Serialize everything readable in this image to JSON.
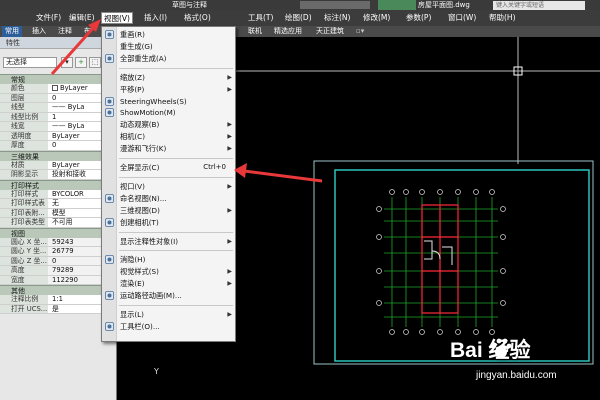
{
  "titlebar": {
    "title": "草图与注释",
    "file": "房屋平面图.dwg",
    "search_placeholder": "键入关键字或短语"
  },
  "menubar": {
    "items": [
      "文件(F)",
      "编辑(E)",
      "视图(V)",
      "插入(I)",
      "格式(O)",
      "工具(T)",
      "绘图(D)",
      "标注(N)",
      "修改(M)",
      "参数(P)",
      "窗口(W)",
      "帮助(H)"
    ],
    "active": "视图(V)"
  },
  "ribbon": {
    "tabs": [
      "常用",
      "插入",
      "注释",
      "布",
      "联机",
      "精选应用",
      "天正建筑"
    ]
  },
  "properties": {
    "title": "特性",
    "selection": "无选择",
    "sections": [
      {
        "name": "常规",
        "rows": [
          [
            "颜色",
            "ByLayer"
          ],
          [
            "图层",
            "0"
          ],
          [
            "线型",
            "—— ByLa"
          ],
          [
            "线型比例",
            "1"
          ],
          [
            "线宽",
            "—— ByLa"
          ],
          [
            "透明度",
            "ByLayer"
          ],
          [
            "厚度",
            "0"
          ]
        ]
      },
      {
        "name": "三维效果",
        "rows": [
          [
            "材质",
            "ByLayer"
          ],
          [
            "阴影显示",
            "投射和接收"
          ]
        ]
      },
      {
        "name": "打印样式",
        "rows": [
          [
            "打印样式",
            "BYCOLOR"
          ],
          [
            "打印样式表",
            "无"
          ],
          [
            "打印表附...",
            "模型"
          ],
          [
            "打印表类型",
            "不可用"
          ]
        ]
      },
      {
        "name": "视图",
        "rows": [
          [
            "圆心 X 坐...",
            "59243"
          ],
          [
            "圆心 Y 坐...",
            "26779"
          ],
          [
            "圆心 Z 坐...",
            "0"
          ],
          [
            "高度",
            "79289"
          ],
          [
            "宽度",
            "112290"
          ]
        ]
      },
      {
        "name": "其他",
        "rows": [
          [
            "注释比例",
            "1:1"
          ],
          [
            "打开 UCS...",
            "是"
          ]
        ]
      }
    ]
  },
  "view_menu": {
    "items": [
      {
        "label": "重画(R)",
        "icon": "redraw-icon"
      },
      {
        "label": "重生成(G)"
      },
      {
        "label": "全部重生成(A)",
        "icon": "regen-all-icon"
      },
      {
        "sep": true
      },
      {
        "label": "缩放(Z)",
        "sub": true
      },
      {
        "label": "平移(P)",
        "sub": true
      },
      {
        "label": "SteeringWheels(S)",
        "icon": "steeringwheel-icon"
      },
      {
        "label": "ShowMotion(M)",
        "icon": "showmotion-icon"
      },
      {
        "label": "动态观察(B)",
        "sub": true
      },
      {
        "label": "相机(C)",
        "sub": true
      },
      {
        "label": "漫游和飞行(K)",
        "sub": true
      },
      {
        "sep": true
      },
      {
        "label": "全屏显示(C)",
        "shortcut": "Ctrl+0"
      },
      {
        "sep": true
      },
      {
        "label": "视口(V)",
        "sub": true
      },
      {
        "label": "命名视图(N)...",
        "icon": "named-views-icon"
      },
      {
        "label": "三维视图(D)",
        "sub": true
      },
      {
        "label": "创建相机(T)",
        "icon": "create-camera-icon"
      },
      {
        "sep": true
      },
      {
        "label": "显示注释性对象(I)",
        "sub": true
      },
      {
        "sep": true
      },
      {
        "label": "消隐(H)",
        "icon": "hide-icon"
      },
      {
        "label": "视觉样式(S)",
        "sub": true
      },
      {
        "label": "渲染(E)",
        "sub": true
      },
      {
        "label": "运动路径动画(M)...",
        "icon": "motion-path-icon"
      },
      {
        "sep": true
      },
      {
        "label": "显示(L)",
        "sub": true
      },
      {
        "label": "工具栏(O)...",
        "icon": "toolbar-icon"
      }
    ]
  },
  "canvas": {
    "ucs_label": "Y"
  },
  "watermark": {
    "brand": "Bai  经验",
    "url": "jingyan.baidu.com"
  },
  "colors": {
    "menu_bg": "#3c3c3c",
    "canvas_bg": "#000000",
    "highlight_arrow": "#e8383a",
    "sheet_border": "#2fd1c9"
  }
}
